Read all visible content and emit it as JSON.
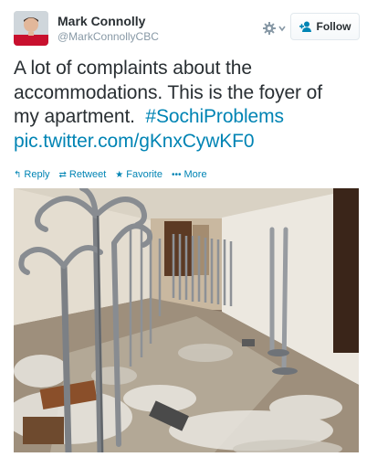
{
  "user": {
    "name": "Mark Connolly",
    "handle": "@MarkConnollyCBC",
    "avatar_icon": "user-avatar"
  },
  "controls": {
    "gear_icon": "gear-icon",
    "follow_label": "Follow",
    "follow_icon": "add-person-icon"
  },
  "tweet": {
    "line1": "A lot of complaints about the",
    "line2": "accommodations.  This is the foyer of",
    "line3_text": "my apartment.",
    "hashtag": "#SochiProblems",
    "link": "pic.twitter.com/gKnxCywKF0"
  },
  "actions": [
    {
      "icon": "reply-icon",
      "label": "Reply"
    },
    {
      "icon": "retweet-icon",
      "label": "Retweet"
    },
    {
      "icon": "star-icon",
      "label": "Favorite"
    },
    {
      "icon": "more-icon",
      "label": "More"
    }
  ],
  "colors": {
    "link": "#0084b4",
    "text": "#292f33",
    "muted": "#8899a6"
  }
}
